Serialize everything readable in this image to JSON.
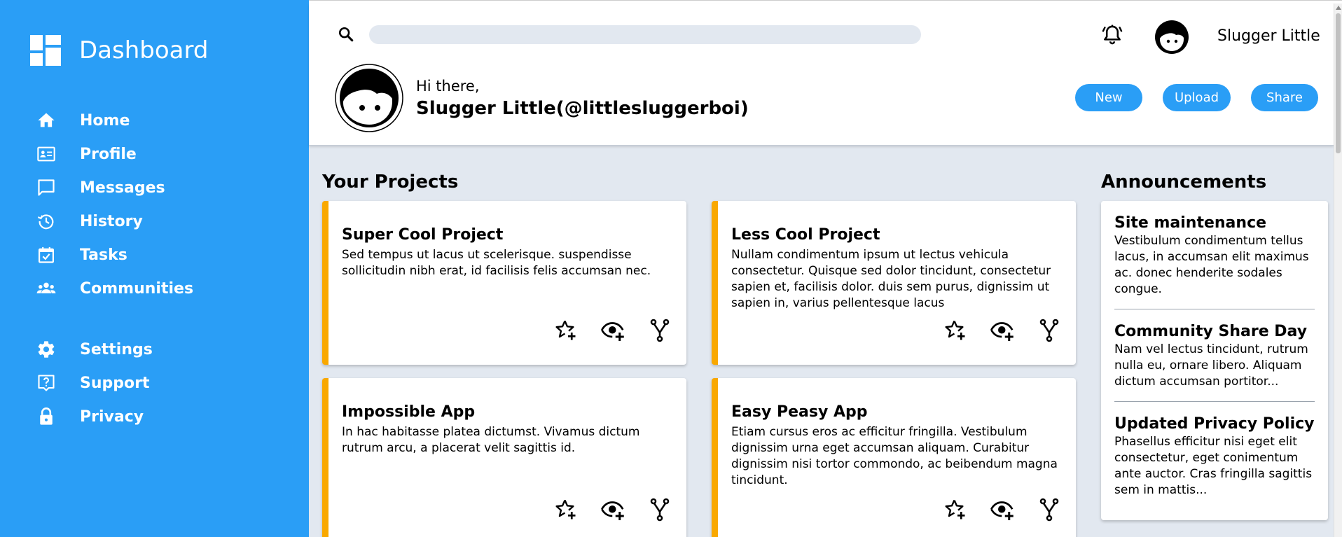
{
  "sidebar": {
    "brand": "Dashboard",
    "nav_main": [
      {
        "label": "Home",
        "icon": "home-icon"
      },
      {
        "label": "Profile",
        "icon": "id-card-icon"
      },
      {
        "label": "Messages",
        "icon": "message-icon"
      },
      {
        "label": "History",
        "icon": "history-icon"
      },
      {
        "label": "Tasks",
        "icon": "calendar-check-icon"
      },
      {
        "label": "Communities",
        "icon": "people-icon"
      }
    ],
    "nav_secondary": [
      {
        "label": "Settings",
        "icon": "gear-icon"
      },
      {
        "label": "Support",
        "icon": "help-icon"
      },
      {
        "label": "Privacy",
        "icon": "lock-icon"
      }
    ]
  },
  "header": {
    "search_placeholder": "",
    "username": "Slugger Little",
    "greeting": "Hi there,",
    "greeting_name": "Slugger Little(@littlesluggerboi)",
    "buttons": {
      "new": "New",
      "upload": "Upload",
      "share": "Share"
    }
  },
  "projects": {
    "title": "Your Projects",
    "items": [
      {
        "title": "Super Cool Project",
        "description": "Sed tempus ut lacus ut scelerisque. suspendisse sollicitudin nibh erat, id facilisis felis accumsan nec."
      },
      {
        "title": "Less Cool Project",
        "description": "Nullam condimentum ipsum ut lectus vehicula consectetur. Quisque sed dolor tincidunt, consectetur sapien et, facilisis dolor. duis sem purus, dignissim ut sapien in, varius pellentesque lacus"
      },
      {
        "title": "Impossible App",
        "description": "In hac habitasse platea dictumst. Vivamus dictum rutrum arcu, a placerat velit sagittis id."
      },
      {
        "title": "Easy Peasy App",
        "description": "Etiam cursus eros ac efficitur fringilla. Vestibulum dignissim urna eget accumsan aliquam. Curabitur dignissim nisi tortor commondo, ac beibendum magna tincidunt."
      }
    ]
  },
  "announcements": {
    "title": "Announcements",
    "items": [
      {
        "title": "Site maintenance",
        "text": "Vestibulum condimentum tellus lacus, in accumsan elit maximus ac. donec henderite sodales congue."
      },
      {
        "title": "Community Share Day",
        "text": "Nam vel lectus tincidunt, rutrum nulla eu, ornare libero. Aliquam dictum accumsan portitor..."
      },
      {
        "title": "Updated Privacy Policy",
        "text": "Phasellus efficitur nisi eget elit consectetur, eget conimentum ante auctor. Cras fringilla sagittis sem in mattis..."
      }
    ]
  },
  "colors": {
    "primary": "#2a9ef6",
    "accent": "#f9a800",
    "background": "#e2e8f0"
  }
}
